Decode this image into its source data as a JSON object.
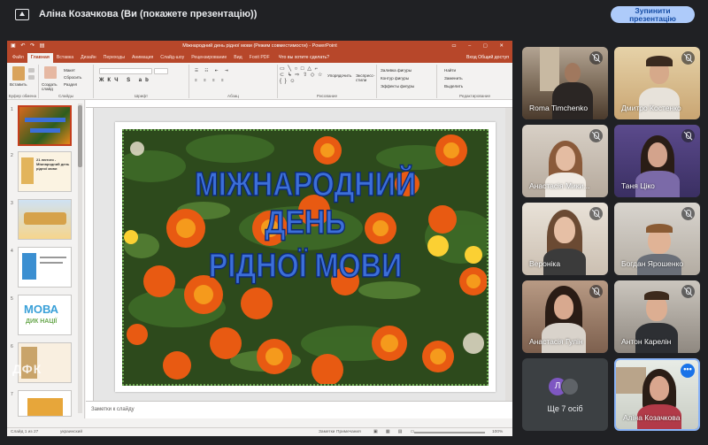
{
  "topbar": {
    "title": "Аліна Козачкова (Ви (покажете презентацію))",
    "stop_button": "Зупинити презентацію"
  },
  "ppt": {
    "window_title": "Міжнародний день рідної мови (Режим совместимости) - PowerPoint",
    "tabs": [
      "Файл",
      "Главная",
      "Вставка",
      "Дизайн",
      "Переходы",
      "Анимация",
      "Слайд-шоу",
      "Рецензирование",
      "Вид",
      "Foxit PDF"
    ],
    "active_tab": "Главная",
    "search_hint": "Что вы хотите сделать?",
    "share": "Вход  Общий доступ",
    "ribbon": {
      "paste": "Вставить",
      "clipboard": "Буфер обмена",
      "new_slide": "Создать слайд",
      "layout": "Макет",
      "reset": "Сбросить",
      "section": "Раздел",
      "slides": "Слайды",
      "font": "Шрифт",
      "paragraph": "Абзац",
      "arrange": "Упорядочить",
      "quick_styles": "Экспресс-стили",
      "drawing": "Рисование",
      "fill": "Заливка фигуры",
      "outline": "Контур фигуры",
      "effects": "Эффекты фигуры",
      "find": "Найти",
      "replace": "Заменить",
      "select": "Выделить",
      "editing": "Редактирование"
    },
    "slide_numbers": [
      "1",
      "2",
      "3",
      "4",
      "5",
      "6",
      "7"
    ],
    "thumb_texts": {
      "t2": "21 лютого - Міжнародний день рідної мови",
      "t5a": "МОВА",
      "t5b": "ДИК НАЦІЇ"
    },
    "slide_title_1": "МІЖНАРОДНИЙ ДЕНЬ",
    "slide_title_2": "РІДНОЇ МОВИ",
    "notes_placeholder": "Заметки к слайду",
    "status": {
      "slide_count": "Слайд 1 из 27",
      "language": "украинский",
      "notes": "Заметки",
      "comments": "Примечания",
      "zoom": "100%"
    }
  },
  "participants": [
    {
      "name": "Roma Timchenko"
    },
    {
      "name": "Дмитро Костенко"
    },
    {
      "name": "Анастасія Мики..."
    },
    {
      "name": "Таня Ціко"
    },
    {
      "name": "Вероніка"
    },
    {
      "name": "Богдан Ярошенко"
    },
    {
      "name": "Анастасія Гулін"
    },
    {
      "name": "Антон Карелін"
    }
  ],
  "more": {
    "label": "Ще 7 осіб",
    "avatar_letter": "Л"
  },
  "self": {
    "name": "Аліна Козачкова",
    "menu": "•••"
  },
  "watermark": "ДФК"
}
